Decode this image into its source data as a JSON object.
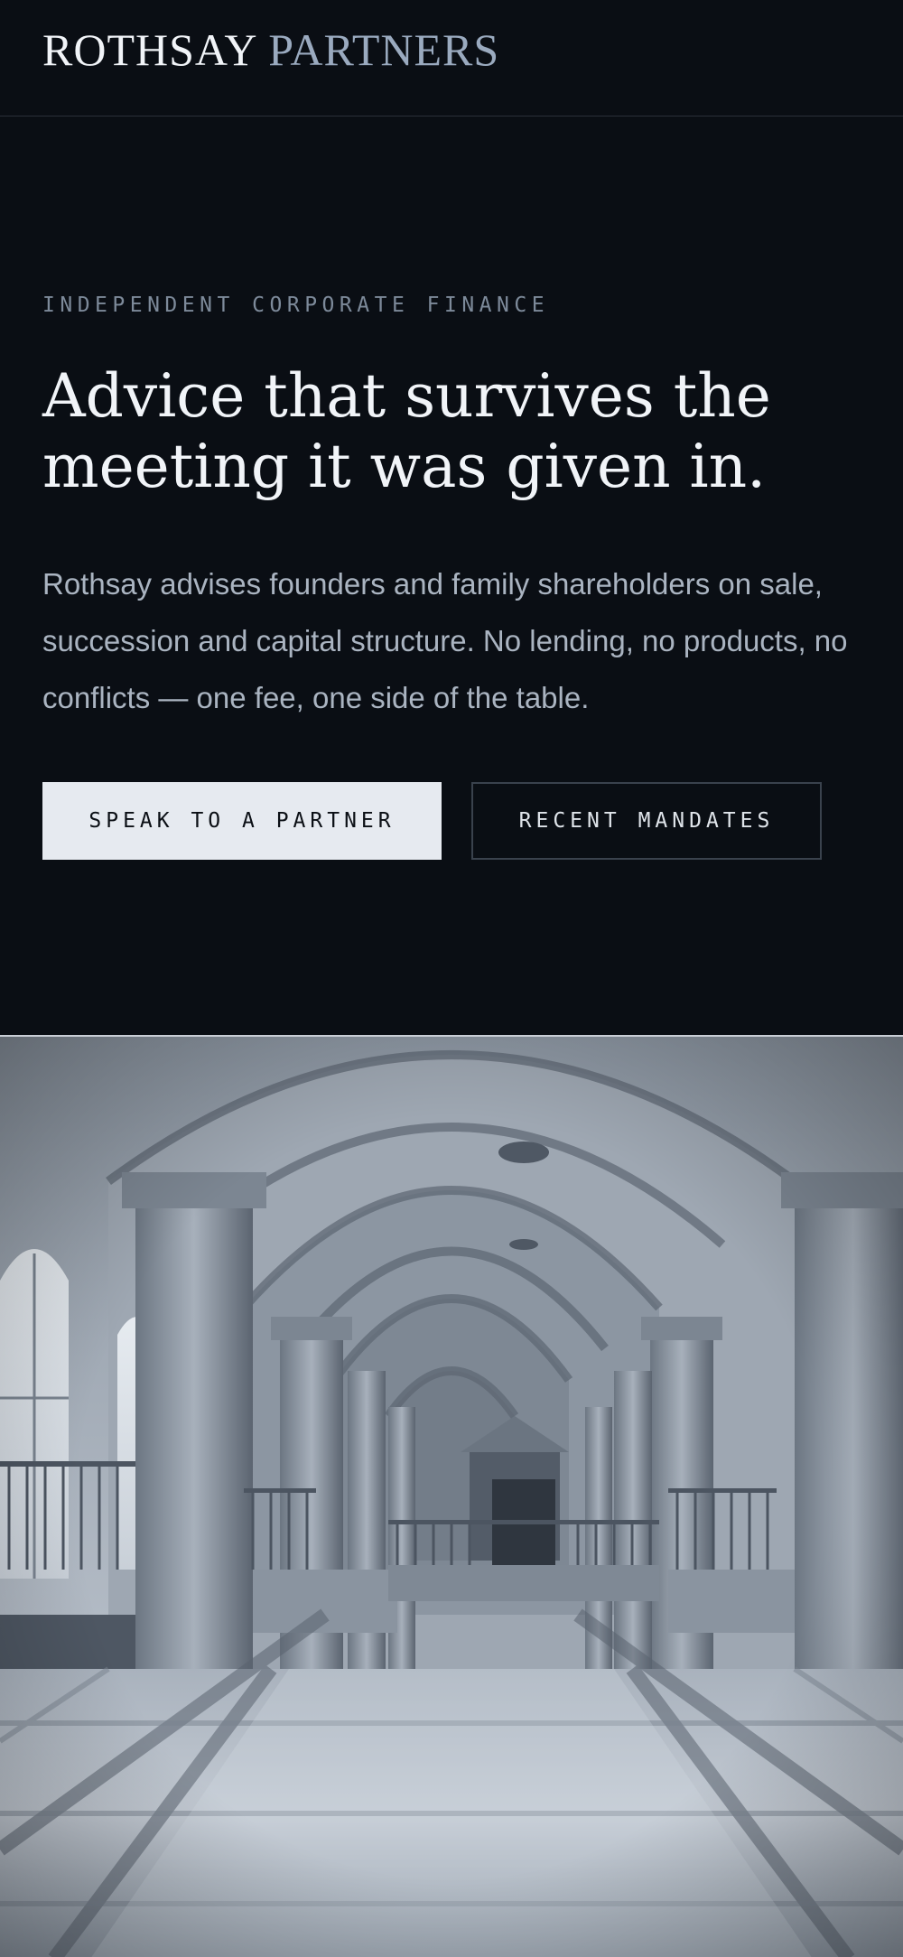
{
  "header": {
    "logo_word_1": "ROTHSAY",
    "logo_word_2": "PARTNERS"
  },
  "hero": {
    "eyebrow": "INDEPENDENT CORPORATE FINANCE",
    "headline": "Advice that survives the meeting it was given in.",
    "lede": "Rothsay advises founders and family shareholders on sale, succession and capital structure. No lending, no products, no conflicts — one fee, one side of the table.",
    "primary_cta": "SPEAK TO A PARTNER",
    "secondary_cta": "RECENT MANDATES"
  },
  "image": {
    "subject": "grand arched stone hall with columns and marble floor",
    "tone": "monochrome blue-grey"
  },
  "colors": {
    "background": "#0a0e14",
    "text_primary": "#f1f4f8",
    "text_muted": "#aab4c1",
    "accent_logo": "#9aaabf",
    "button_fill": "#e6eaf0"
  }
}
